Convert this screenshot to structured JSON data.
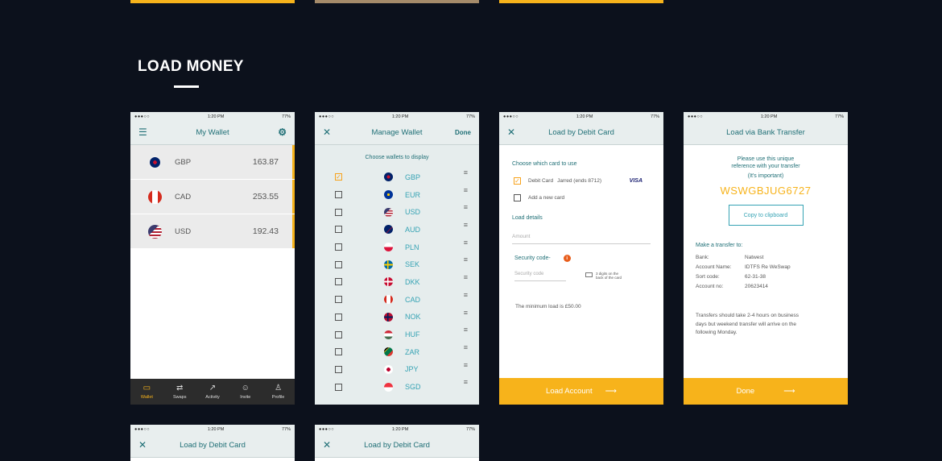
{
  "section_title": "LOAD MONEY",
  "status": {
    "time": "1:20 PM",
    "signal": "●●●○○",
    "battery": "77%"
  },
  "wallet": {
    "title": "My Wallet",
    "rows": [
      {
        "code": "GBP",
        "amount": "163.87"
      },
      {
        "code": "CAD",
        "amount": "253.55"
      },
      {
        "code": "USD",
        "amount": "192.43"
      }
    ],
    "tabs": [
      {
        "label": "Wallet",
        "icon": "wallet-icon"
      },
      {
        "label": "Swaps",
        "icon": "swap-icon"
      },
      {
        "label": "Activity",
        "icon": "activity-icon"
      },
      {
        "label": "Invite",
        "icon": "invite-icon"
      },
      {
        "label": "Profile",
        "icon": "profile-icon"
      }
    ]
  },
  "manage": {
    "title": "Manage Wallet",
    "done": "Done",
    "subtitle": "Choose wallets to display",
    "currencies": [
      "GBP",
      "EUR",
      "USD",
      "AUD",
      "PLN",
      "SEK",
      "DKK",
      "CAD",
      "NOK",
      "HUF",
      "ZAR",
      "JPY",
      "SGD"
    ]
  },
  "debit": {
    "title": "Load by Debit Card",
    "choose": "Choose which card to use",
    "card_name": "Debit Card",
    "card_owner": "Jarred (ends 8712)",
    "card_brand": "VISA",
    "add_card": "Add a new card",
    "load_details": "Load details",
    "amount_placeholder": "Amount",
    "security_label": "Security code-",
    "security_placeholder": "Security code",
    "security_hint_1": "3 digits on the",
    "security_hint_2": "back of the card",
    "min_load": "The minimum load is £50.00",
    "cta": "Load Account"
  },
  "bank": {
    "title": "Load via Bank Transfer",
    "instr_1": "Please use this unique",
    "instr_2": "reference with your transfer",
    "important": "(It's important)",
    "reference": "WSWGBJUG6727",
    "copy": "Copy to clipboard",
    "make_transfer": "Make a transfer to:",
    "details": [
      {
        "k": "Bank:",
        "v": "Natwest"
      },
      {
        "k": "Account Name:",
        "v": "IDTFS Re WeSwap"
      },
      {
        "k": "Sort code:",
        "v": "62-31-38"
      },
      {
        "k": "Account no:",
        "v": "20623414"
      }
    ],
    "note_1": "Transfers should take 2-4 hours on business",
    "note_2": "days but weekend transfer will arrive on the",
    "note_3": "following Monday.",
    "cta": "Done"
  },
  "colors": {
    "accent": "#f7b31b",
    "teal": "#1f6f76",
    "background": "#0c111c"
  }
}
